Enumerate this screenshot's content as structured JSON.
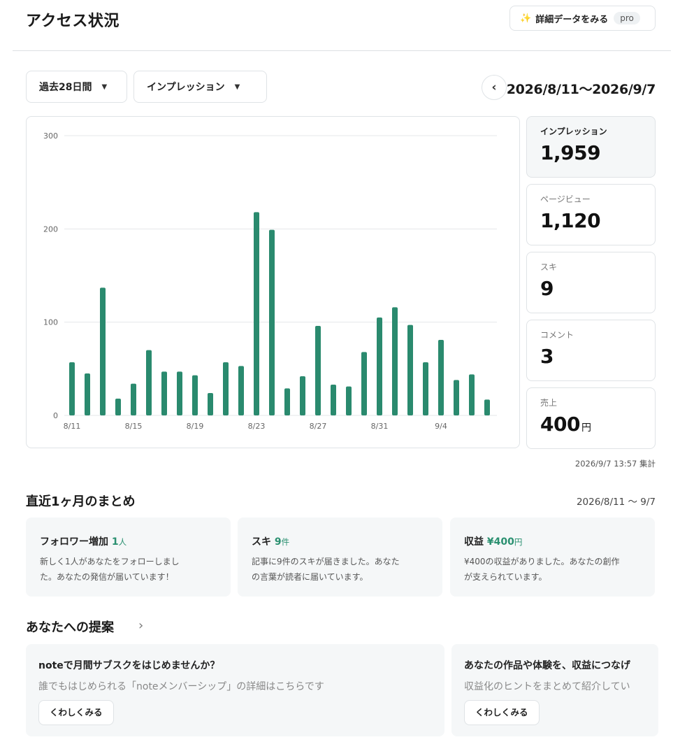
{
  "header": {
    "title": "アクセス状況",
    "detail_button": {
      "icon": "sparkle-icon",
      "label": "詳細データをみる",
      "badge": "pro"
    }
  },
  "filters": {
    "period": "過去28日間",
    "metric": "インプレッション",
    "date_range": "2026/8/11〜2026/9/7"
  },
  "chart_data": {
    "type": "bar",
    "categories": [
      "8/11",
      "8/12",
      "8/13",
      "8/14",
      "8/15",
      "8/16",
      "8/17",
      "8/18",
      "8/19",
      "8/20",
      "8/21",
      "8/22",
      "8/23",
      "8/24",
      "8/25",
      "8/26",
      "8/27",
      "8/28",
      "8/29",
      "8/30",
      "8/31",
      "9/1",
      "9/2",
      "9/3",
      "9/4",
      "9/5",
      "9/6",
      "9/7"
    ],
    "x_tick_labels": [
      "8/11",
      "8/15",
      "8/19",
      "8/23",
      "8/27",
      "8/31",
      "9/4"
    ],
    "values": [
      57,
      45,
      137,
      18,
      34,
      70,
      47,
      47,
      43,
      24,
      57,
      53,
      218,
      199,
      29,
      42,
      96,
      33,
      31,
      68,
      105,
      116,
      97,
      57,
      81,
      38,
      44,
      17
    ],
    "y_ticks": [
      0,
      100,
      200,
      300
    ],
    "ylim": [
      0,
      300
    ],
    "grid": true,
    "bar_color": "#2a8a6e"
  },
  "stats": [
    {
      "label": "インプレッション",
      "value": "1,959",
      "unit": "",
      "active": true
    },
    {
      "label": "ページビュー",
      "value": "1,120",
      "unit": "",
      "active": false
    },
    {
      "label": "スキ",
      "value": "9",
      "unit": "",
      "active": false
    },
    {
      "label": "コメント",
      "value": "3",
      "unit": "",
      "active": false
    },
    {
      "label": "売上",
      "value": "400",
      "unit": "円",
      "active": false
    }
  ],
  "aggregated_at": "2026/9/7 13:57 集計",
  "summary": {
    "title": "直近1ヶ月のまとめ",
    "range": "2026/8/11 〜 9/7",
    "cards": [
      {
        "label": "フォロワー増加",
        "value": "1",
        "unit": "人",
        "desc_line1": "新しく1人があなたをフォローしまし",
        "desc_line2": "た。あなたの発信が届いています！"
      },
      {
        "label": "スキ",
        "value": "9",
        "unit": "件",
        "desc_line1": "記事に9件のスキが届きました。あなた",
        "desc_line2": "の言葉が読者に届いています。"
      },
      {
        "label": "収益",
        "value": "¥400",
        "unit": "円",
        "desc_line1": "¥400の収益がありました。あなたの創作",
        "desc_line2": "が支えられています。"
      }
    ]
  },
  "suggestions": {
    "title": "あなたへの提案",
    "cards": [
      {
        "title": "noteで月間サブスクをはじめませんか？",
        "desc": "誰でもはじめられる「noteメンバーシップ」の詳細はこちらです",
        "button": "くわしくみる"
      },
      {
        "title": "あなたの作品や体験を、収益につなげ",
        "desc": "収益化のヒントをまとめて紹介してい",
        "button": "くわしくみる"
      }
    ]
  }
}
